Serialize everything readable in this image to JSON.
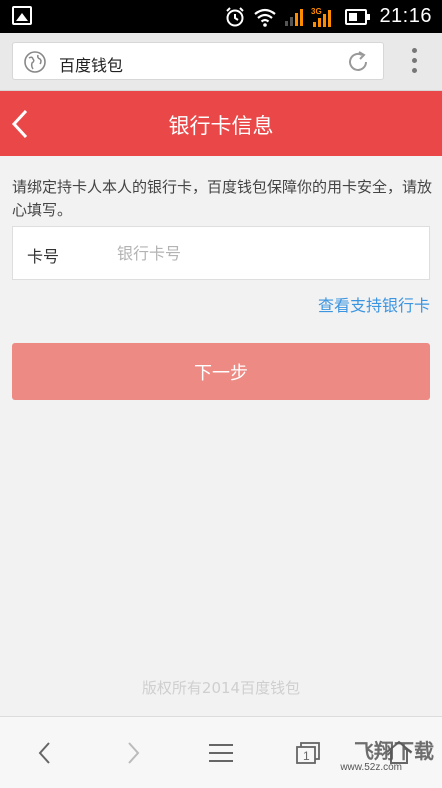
{
  "status_bar": {
    "time": "21:16",
    "network": "3G",
    "icons": [
      "image-icon",
      "alarm-icon",
      "wifi-icon",
      "signal-icon",
      "signal-3g-icon",
      "battery-icon"
    ]
  },
  "browser": {
    "url_text": "百度钱包",
    "icons": [
      "globe-icon",
      "reload-icon",
      "overflow-menu-icon"
    ]
  },
  "header": {
    "title": "银行卡信息",
    "back_icon": "chevron-left-icon",
    "background": "#ea4848"
  },
  "form": {
    "intro": "请绑定持卡人本人的银行卡，百度钱包保障你的用卡安全，请放心填写。",
    "card_label": "卡号",
    "card_placeholder": "银行卡号",
    "card_value": "",
    "support_link": "查看支持银行卡",
    "next_button": "下一步",
    "link_color": "#3c95e0",
    "button_color": "#ee8a84"
  },
  "footer": {
    "copyright": "版权所有2014百度钱包"
  },
  "bottom_nav": {
    "items": [
      "back-icon",
      "forward-icon",
      "menu-icon",
      "tabs-icon",
      "home-icon"
    ],
    "tabs_count": "1"
  },
  "watermark": {
    "brand": "飞翔下载",
    "site": "www.52z.com"
  }
}
